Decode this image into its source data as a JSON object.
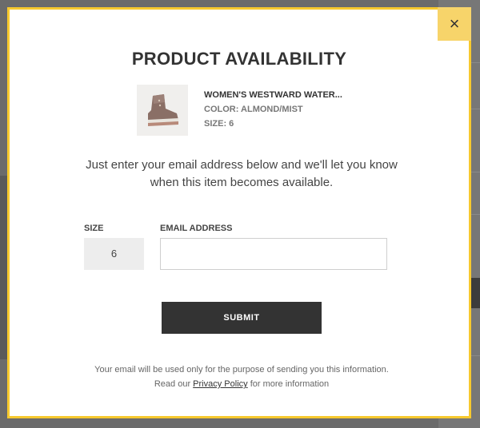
{
  "modal": {
    "close_label": "×",
    "title": "PRODUCT AVAILABILITY",
    "product": {
      "name": "WOMEN'S WESTWARD WATER...",
      "color": "COLOR: ALMOND/MIST",
      "size": "SIZE: 6",
      "image_alt": "boot-thumbnail"
    },
    "intro_text": "Just enter your email address below and we'll let you know when this item becomes available.",
    "form": {
      "size_label": "SIZE",
      "size_value": "6",
      "email_label": "EMAIL ADDRESS",
      "email_value": "",
      "submit_label": "SUBMIT"
    },
    "disclaimer": {
      "prefix": "Your email will be used only for the purpose of sending you this information. Read our ",
      "link_text": "Privacy Policy",
      "suffix": " for more information"
    }
  },
  "colors": {
    "accent_border": "#f7c92e",
    "close_bg": "#f7d46a",
    "submit_bg": "#333333"
  }
}
